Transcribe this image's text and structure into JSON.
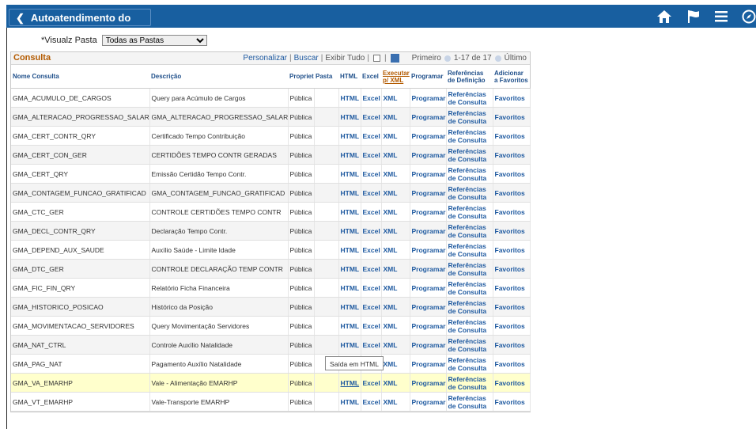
{
  "header": {
    "title": "Autoatendimento do Gerente",
    "icons": [
      "home-icon",
      "flag-icon",
      "menu-icon",
      "compass-icon"
    ]
  },
  "view": {
    "label": "*Visualz Pasta",
    "selected": "Todas as Pastas"
  },
  "grid": {
    "title": "Consulta",
    "personalize": "Personalizar",
    "find": "Buscar",
    "view_all": "Exibir Tudo",
    "first": "Primeiro",
    "range": "1-17 de 17",
    "last": "Último",
    "columns": {
      "name": "Nome Consulta",
      "desc": "Descrição",
      "owner": "Propriet",
      "folder": "Pasta",
      "html": "HTML",
      "excel": "Excel",
      "xml": "Executar p/ XML",
      "schedule": "Programar",
      "refs": "Referências de Definição",
      "fav": "Adicionar a Favoritos"
    },
    "link_labels": {
      "html": "HTML",
      "excel": "Excel",
      "xml": "XML",
      "schedule": "Programar",
      "refs": "Referências de Consulta",
      "fav": "Favoritos"
    },
    "rows": [
      {
        "name": "GMA_ACUMULO_DE_CARGOS",
        "desc": "Query para Acúmulo de Cargos",
        "owner": "Pública"
      },
      {
        "name": "GMA_ALTERACAO_PROGRESSAO_SALAR",
        "desc": "GMA_ALTERACAO_PROGRESSAO_SALAR",
        "owner": "Pública"
      },
      {
        "name": "GMA_CERT_CONTR_QRY",
        "desc": "Certificado Tempo Contribuição",
        "owner": "Pública"
      },
      {
        "name": "GMA_CERT_CON_GER",
        "desc": "CERTIDÕES TEMPO CONTR GERADAS",
        "owner": "Pública"
      },
      {
        "name": "GMA_CERT_QRY",
        "desc": "Emissão Certidão Tempo Contr.",
        "owner": "Pública"
      },
      {
        "name": "GMA_CONTAGEM_FUNCAO_GRATIFICAD",
        "desc": "GMA_CONTAGEM_FUNCAO_GRATIFICAD",
        "owner": "Pública"
      },
      {
        "name": "GMA_CTC_GER",
        "desc": "CONTROLE CERTIDÕES TEMPO CONTR",
        "owner": "Pública"
      },
      {
        "name": "GMA_DECL_CONTR_QRY",
        "desc": "Declaração Tempo Contr.",
        "owner": "Pública"
      },
      {
        "name": "GMA_DEPEND_AUX_SAUDE",
        "desc": "Auxílio Saúde - Limite Idade",
        "owner": "Pública"
      },
      {
        "name": "GMA_DTC_GER",
        "desc": "CONTROLE DECLARAÇÃO TEMP CONTR",
        "owner": "Pública"
      },
      {
        "name": "GMA_FIC_FIN_QRY",
        "desc": "Relatório Ficha Financeira",
        "owner": "Pública"
      },
      {
        "name": "GMA_HISTORICO_POSICAO",
        "desc": "Histórico da Posição",
        "owner": "Pública"
      },
      {
        "name": "GMA_MOVIMENTACAO_SERVIDORES",
        "desc": "Query Movimentação Servidores",
        "owner": "Pública"
      },
      {
        "name": "GMA_NAT_CTRL",
        "desc": "Controle Auxílio Natalidade",
        "owner": "Pública"
      },
      {
        "name": "GMA_PAG_NAT",
        "desc": "Pagamento Auxílio Natalidade",
        "owner": "Pública"
      },
      {
        "name": "GMA_VA_EMARHP",
        "desc": "Vale - Alimentação EMARHP",
        "owner": "Pública"
      },
      {
        "name": "GMA_VT_EMARHP",
        "desc": "Vale-Transporte EMARHP",
        "owner": "Pública"
      }
    ]
  },
  "tooltip": "Saída em HTML"
}
